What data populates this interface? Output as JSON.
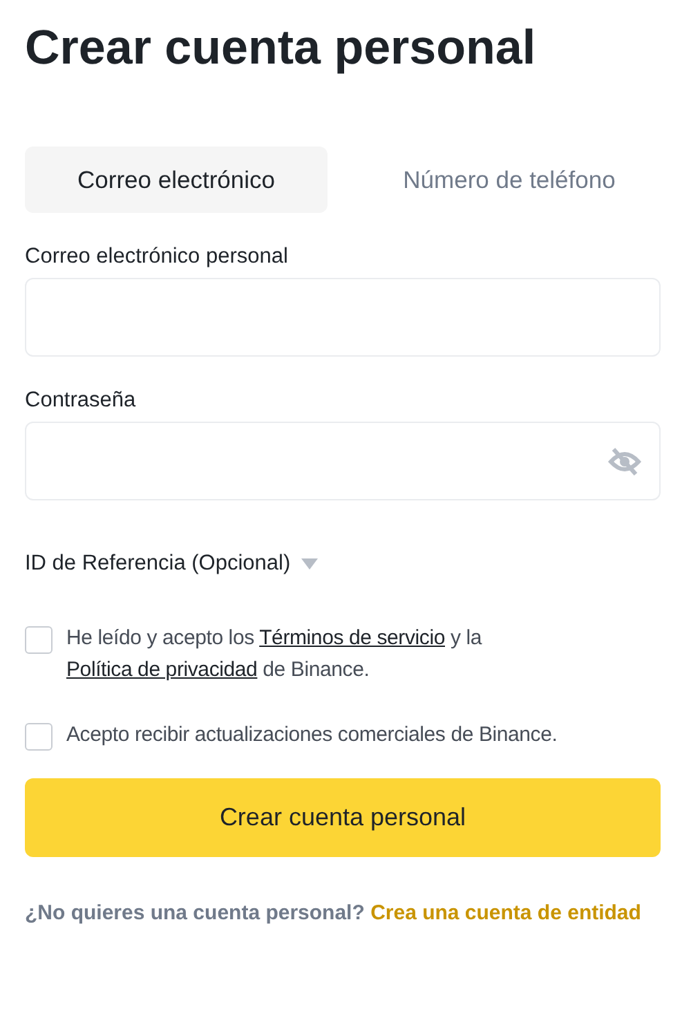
{
  "title": "Crear cuenta personal",
  "tabs": [
    {
      "label": "Correo electrónico",
      "selected": true
    },
    {
      "label": "Número de teléfono",
      "selected": false
    }
  ],
  "fields": [
    {
      "label": "Correo electrónico personal",
      "kind": "text"
    },
    {
      "label": "Contraseña",
      "kind": "password"
    }
  ],
  "referral": {
    "label": "ID de Referencia (Opcional)",
    "expanded": false
  },
  "agreements": [
    {
      "checked": false,
      "parts": [
        {
          "text": "He leído y acepto los ",
          "link": false
        },
        {
          "text": "Términos de servicio",
          "link": true
        },
        {
          "text": " y la ",
          "link": false
        },
        {
          "text": "Política de privacidad",
          "link": true
        },
        {
          "text": " de Binance.",
          "link": false
        }
      ]
    },
    {
      "checked": false,
      "parts": [
        {
          "text": "Acepto recibir actualizaciones comerciales de Binance.",
          "link": false
        }
      ]
    }
  ],
  "submit": "Crear cuenta personal",
  "footer": {
    "question": "¿No quieres una cuenta personal?",
    "link": "Crea una cuenta de entidad"
  }
}
